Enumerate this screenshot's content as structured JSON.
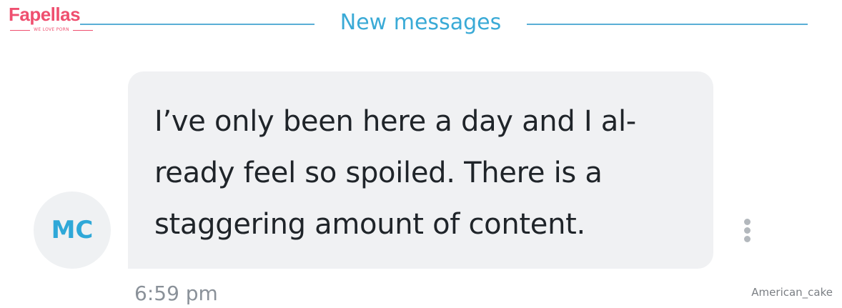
{
  "watermark": {
    "logo_text": "Fapellas",
    "logo_tagline": "WE LOVE PORN",
    "brand_color": "#ef4f6f",
    "username": "American_cake"
  },
  "divider": {
    "label": "New messages",
    "color": "#3aaad6"
  },
  "message": {
    "avatar_initials": "MC",
    "text_lines": [
      "I’ve only been here a day and I al-",
      "ready feel so spoiled. There is a",
      "staggering amount of content."
    ],
    "timestamp": "6:59 pm",
    "bubble_color": "#f0f1f3",
    "menu_icon": "more-vertical-icon"
  }
}
